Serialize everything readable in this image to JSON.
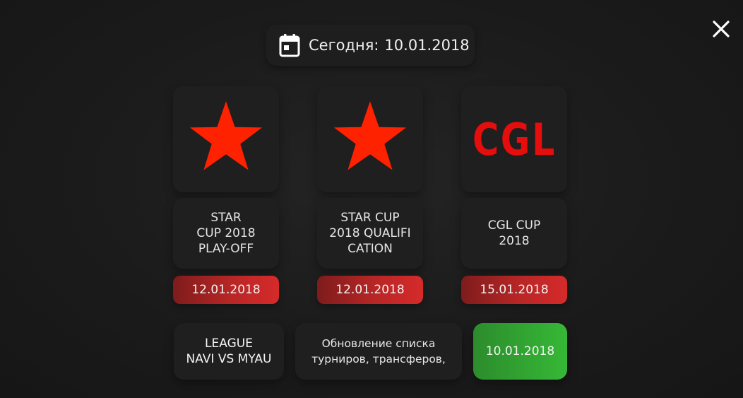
{
  "header": {
    "date_prefix": "Сегодня:",
    "date_value": "10.01.2018",
    "calendar_icon": "calendar-icon",
    "close_icon": "close-icon"
  },
  "tournaments": [
    {
      "logo": "star-icon",
      "name": "STAR\nCUP 2018\nPLAY-OFF",
      "date": "12.01.2018"
    },
    {
      "logo": "star-icon",
      "name": "STAR CUP\n2018 QUALIFI\nCATION",
      "date": "12.01.2018"
    },
    {
      "logo": "cgl-logo",
      "logo_text": "CGL",
      "name": "CGL CUP 2018",
      "date": "15.01.2018"
    }
  ],
  "bottom": {
    "league_text": "LEAGUE\nNAVI VS MYAU",
    "update_text": "Обновление списка\nтурниров, трансферов,",
    "today_date": "10.01.2018"
  },
  "colors": {
    "accent_red": "#e8200e",
    "badge_red": "#b82626",
    "badge_green": "#36b836",
    "background": "#1b1b1b"
  }
}
